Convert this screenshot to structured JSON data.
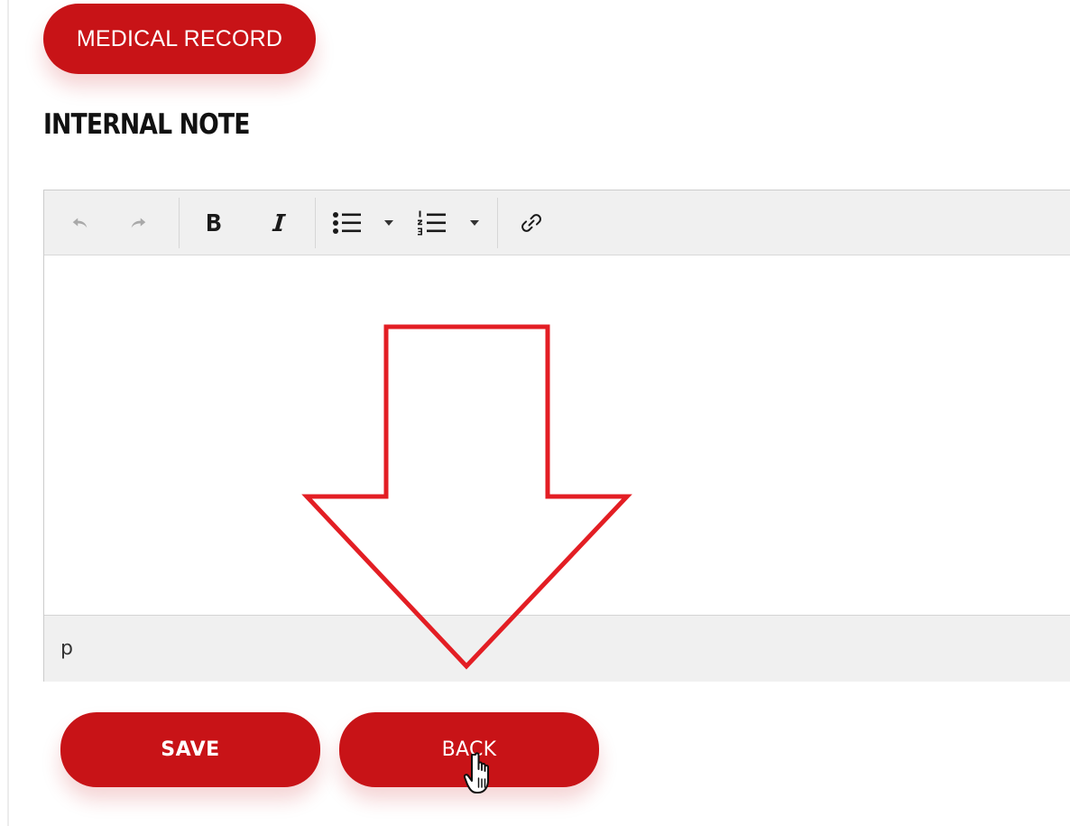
{
  "top_button": {
    "label": "MEDICAL RECORD"
  },
  "section": {
    "heading": "INTERNAL NOTE"
  },
  "editor": {
    "toolbar": {
      "undo_icon": "undo-icon",
      "redo_icon": "redo-icon",
      "bold_icon": "bold-icon",
      "italic_icon": "italic-icon",
      "bullet_list_icon": "bullet-list-icon",
      "numbered_list_icon": "numbered-list-icon",
      "dropdown_icon": "chevron-down-icon",
      "link_icon": "link-icon"
    },
    "content": "",
    "status_path": "p"
  },
  "actions": {
    "save_label": "SAVE",
    "back_label": "BACK"
  },
  "annotation": {
    "arrow_color": "#e31e24",
    "cursor": "hand-pointer-icon"
  },
  "colors": {
    "accent": "#c81317",
    "toolbar_bg": "#f0f0f0",
    "border": "#cccccc",
    "heading": "#111111"
  }
}
